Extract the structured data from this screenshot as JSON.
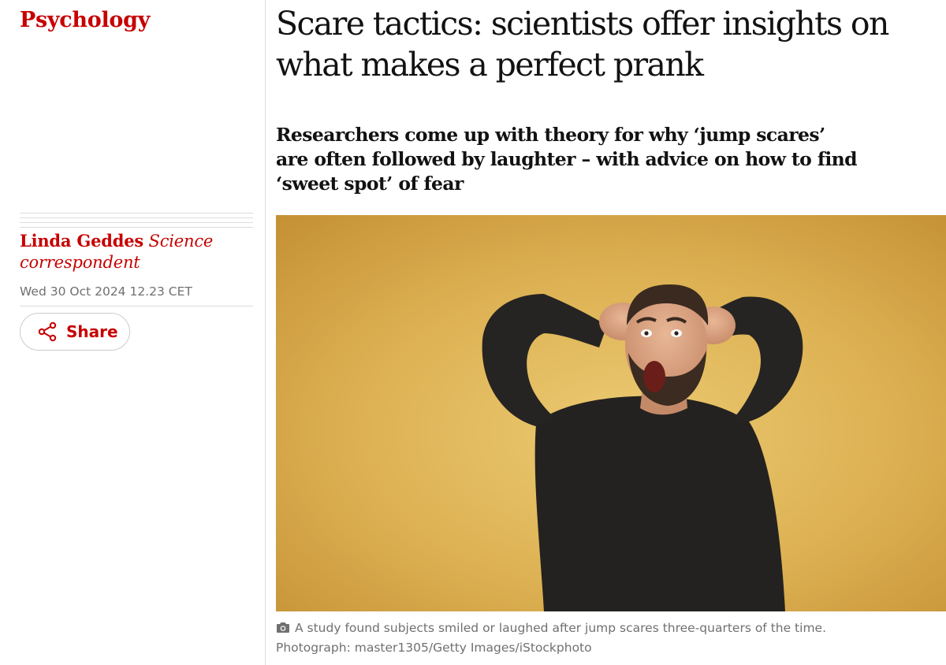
{
  "section": {
    "label": "Psychology"
  },
  "article": {
    "headline": "Scare tactics: scientists offer insights on what makes a perfect prank",
    "standfirst": "Researchers come up with theory for why ‘jump scares’ are often followed by laughter – with advice on how to find ‘sweet spot’ of fear"
  },
  "byline": {
    "author": "Linda Geddes",
    "role": "Science correspondent"
  },
  "dateline": "Wed 30 Oct 2024 12.23 CET",
  "share": {
    "label": "Share",
    "icon": "share-icon"
  },
  "image": {
    "caption": "A study found subjects smiled or laughed after jump scares three-quarters of the time.",
    "credit": "Photograph: master1305/Getty Images/iStockphoto",
    "caption_icon": "camera-icon"
  },
  "colors": {
    "accent": "#c70000",
    "text": "#121212",
    "muted": "#707070",
    "rule": "#dcdcdc",
    "photo_background": "#d9aa45"
  }
}
